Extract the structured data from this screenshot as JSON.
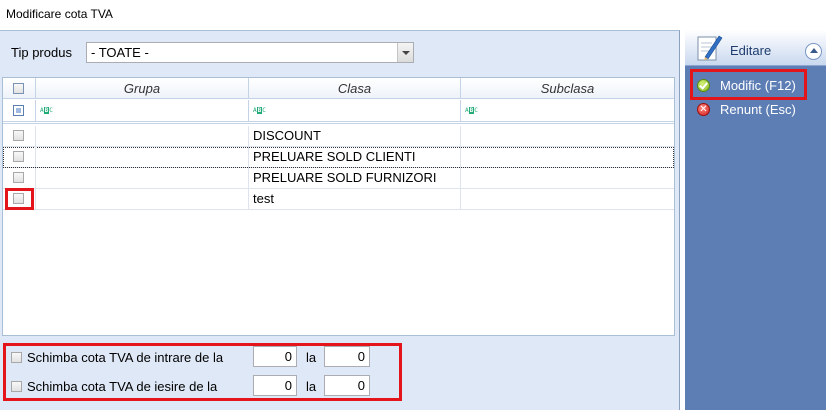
{
  "window": {
    "title": "Modificare cota TVA"
  },
  "filter": {
    "label": "Tip produs",
    "value": "- TOATE -"
  },
  "grid": {
    "columns": [
      "Grupa",
      "Clasa",
      "Subclasa"
    ],
    "autofilter_icon": "abc-text-filter-icon",
    "rows": [
      {
        "grupa": "",
        "clasa": "DISCOUNT",
        "subclasa": ""
      },
      {
        "grupa": "",
        "clasa": "PRELUARE SOLD CLIENTI",
        "subclasa": ""
      },
      {
        "grupa": "",
        "clasa": "PRELUARE SOLD FURNIZORI",
        "subclasa": ""
      },
      {
        "grupa": "",
        "clasa": "test",
        "subclasa": ""
      }
    ]
  },
  "options": {
    "intrare": {
      "label": "Schimba cota TVA de intrare de la",
      "from": "0",
      "to_label": "la",
      "to": "0"
    },
    "iesire": {
      "label": "Schimba cota TVA de iesire de la",
      "from": "0",
      "to_label": "la",
      "to": "0"
    }
  },
  "sidebar": {
    "group_label": "Editare",
    "group_icon": "edit-document-icon",
    "items": [
      {
        "label": "Modific (F12)",
        "icon": "ok-check-icon"
      },
      {
        "label": "Renunt (Esc)",
        "icon": "cancel-x-icon"
      }
    ]
  },
  "colors": {
    "highlight": "#e3151a",
    "sidebar_bg": "#5d7db5",
    "panel_bg": "#dfe8f6"
  }
}
